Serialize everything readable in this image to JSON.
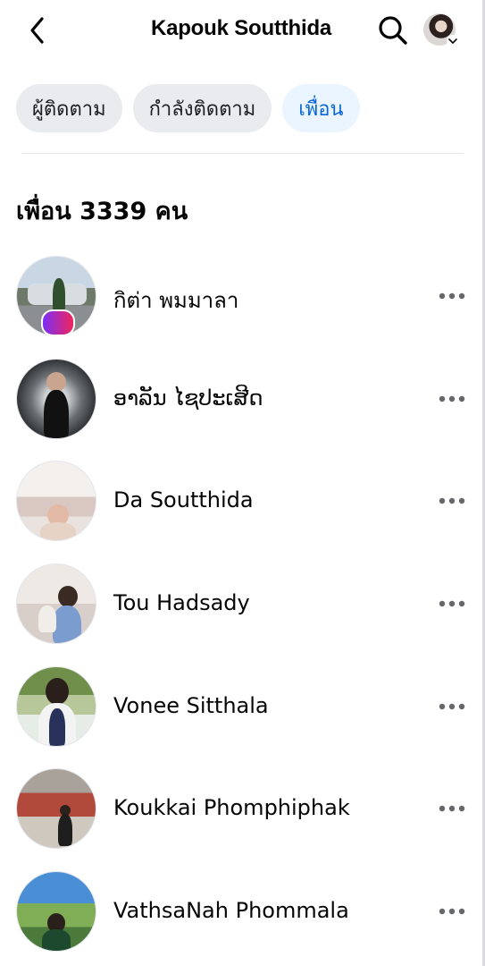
{
  "header": {
    "title": "Kapouk Soutthida"
  },
  "tabs": [
    {
      "label": "ผู้ติดตาม"
    },
    {
      "label": "กำลังติดตาม"
    },
    {
      "label": "เพื่อน"
    }
  ],
  "selected_tab": "เพื่อน",
  "section": {
    "title": "เพื่อน 3339 คน"
  },
  "friends": [
    {
      "name": "กิต่า พมมาลา"
    },
    {
      "name": "ອາລັນ ໄຊປະເສີດ"
    },
    {
      "name": "Da Soutthida"
    },
    {
      "name": "Tou Hadsady"
    },
    {
      "name": "Vonee Sitthala"
    },
    {
      "name": "Koukkai Phomphiphak"
    },
    {
      "name": "VathsaNah Phommala"
    }
  ],
  "icons": {
    "back": "chevron-left-icon",
    "search": "search-icon",
    "more": "more-horizontal-icon",
    "profile_menu": "chevron-down-icon"
  },
  "colors": {
    "accent": "#0a66d8",
    "tab_active_bg": "#ebf5ff",
    "tab_bg": "#e9ebee"
  }
}
